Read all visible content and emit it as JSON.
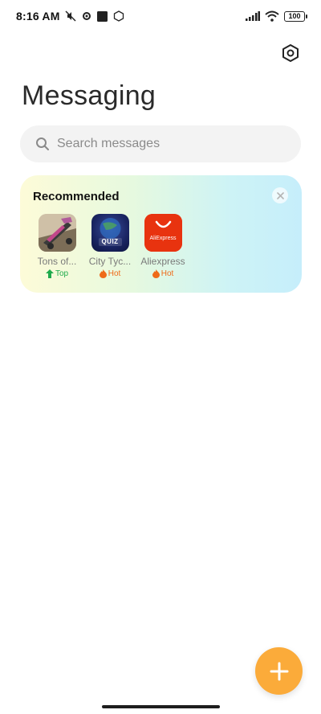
{
  "status_bar": {
    "time": "8:16 AM",
    "battery": "100"
  },
  "header": {
    "title": "Messaging"
  },
  "search": {
    "placeholder": "Search messages"
  },
  "recommended": {
    "title": "Recommended",
    "apps": [
      {
        "name": "Tons of...",
        "badge": "Top",
        "badge_type": "top"
      },
      {
        "name": "City Tyc...",
        "badge": "Hot",
        "badge_type": "hot",
        "icon_text": "QUIZ"
      },
      {
        "name": "Aliexpress",
        "badge": "Hot",
        "badge_type": "hot",
        "icon_text": "AliExpress"
      }
    ]
  },
  "colors": {
    "fab": "#fbab3a",
    "badge_top": "#1faa4c",
    "badge_hot": "#ef6a19"
  }
}
